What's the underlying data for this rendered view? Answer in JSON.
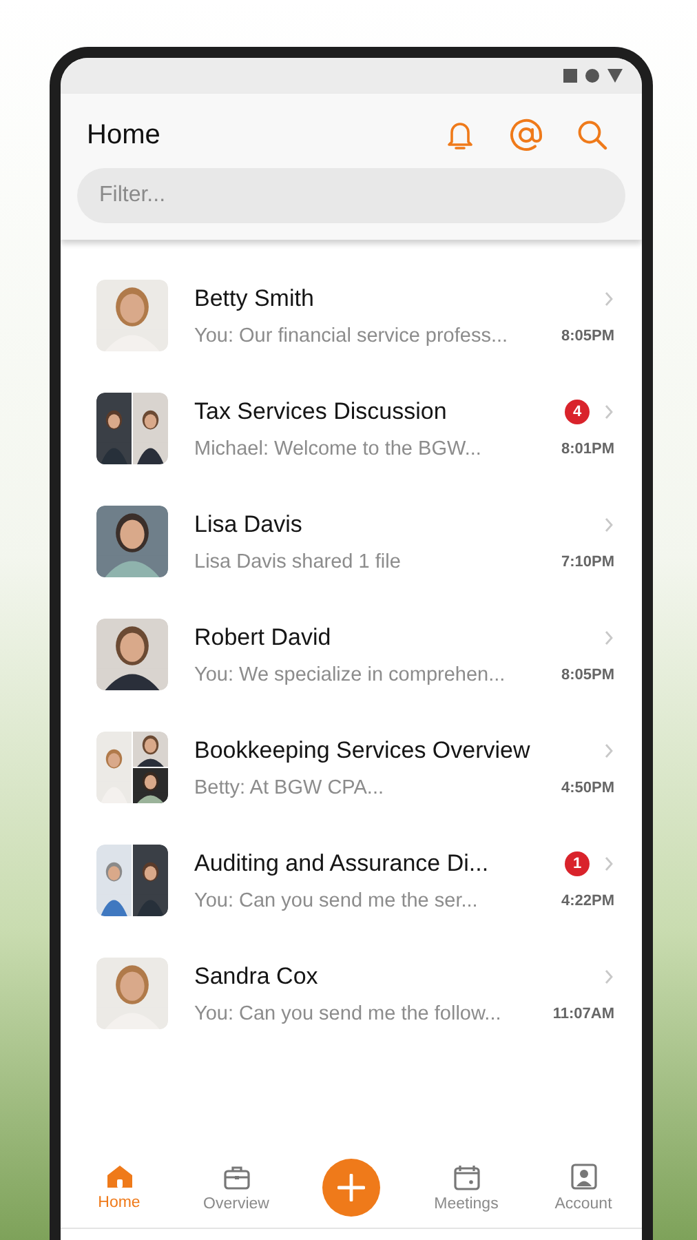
{
  "header": {
    "title": "Home"
  },
  "filter": {
    "placeholder": "Filter..."
  },
  "conversations": [
    {
      "name": "Betty Smith",
      "preview": "You: Our financial service profess...",
      "time": "8:05PM",
      "avatar": {
        "kind": "single"
      }
    },
    {
      "name": "Tax Services Discussion",
      "preview": "Michael:  Welcome to the BGW...",
      "time": "8:01PM",
      "badge": "4",
      "avatar": {
        "kind": "pair"
      }
    },
    {
      "name": "Lisa Davis",
      "preview": "Lisa Davis shared 1 file",
      "time": "7:10PM",
      "avatar": {
        "kind": "single"
      }
    },
    {
      "name": "Robert David",
      "preview": "You: We specialize in comprehen...",
      "time": "8:05PM",
      "avatar": {
        "kind": "single"
      }
    },
    {
      "name": "Bookkeeping Services Overview",
      "preview": "Betty:  At BGW CPA...",
      "time": "4:50PM",
      "avatar": {
        "kind": "trio"
      }
    },
    {
      "name": "Auditing and Assurance Di...",
      "preview": "You:  Can you send me the ser...",
      "time": "4:22PM",
      "badge": "1",
      "avatar": {
        "kind": "pair"
      }
    },
    {
      "name": "Sandra Cox",
      "preview": "You: Can you send me the follow...",
      "time": "11:07AM",
      "avatar": {
        "kind": "single"
      }
    }
  ],
  "nav": [
    {
      "kind": "home",
      "label": "Home",
      "selected": true
    },
    {
      "kind": "briefcase",
      "label": "Overview",
      "selected": false
    },
    {
      "kind": "add"
    },
    {
      "kind": "calendar",
      "label": "Meetings",
      "selected": false
    },
    {
      "kind": "account",
      "label": "Account",
      "selected": false
    }
  ]
}
